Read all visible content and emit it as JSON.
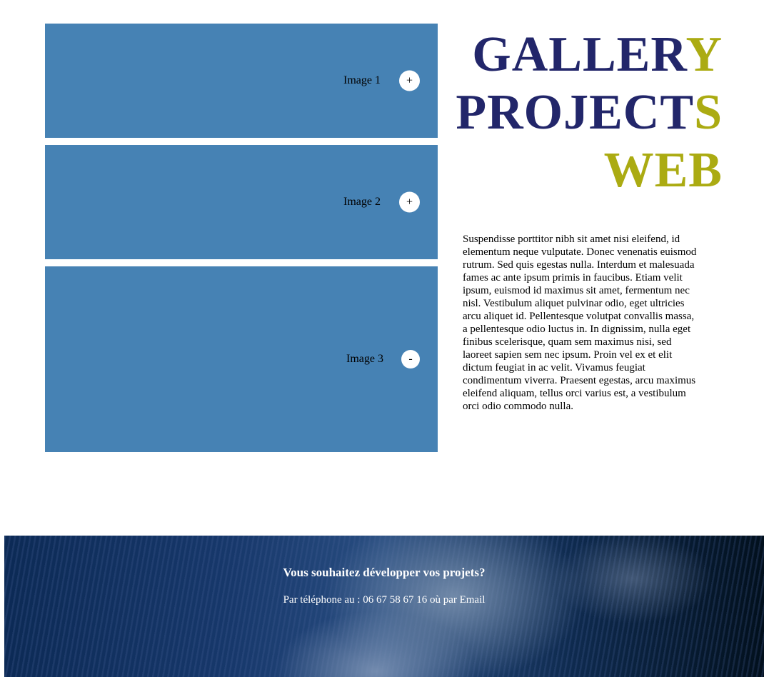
{
  "gallery": {
    "items": [
      {
        "label": "Image 1",
        "toggle": "+"
      },
      {
        "label": "Image 2",
        "toggle": "+"
      },
      {
        "label": "Image 3",
        "toggle": "-"
      }
    ]
  },
  "title": {
    "line1_main": "GALLER",
    "line1_accent": "Y",
    "line2_main": "PROJECT",
    "line2_accent": "S",
    "line3": "WEB"
  },
  "intro": {
    "text": "Suspendisse porttitor nibh sit amet nisi eleifend, id elementum neque vulputate. Donec venenatis euismod rutrum. Sed quis egestas nulla. Interdum et malesuada fames ac ante ipsum primis in faucibus. Etiam velit ipsum, euismod id maximus sit amet, fermentum nec nisl. Vestibulum aliquet pulvinar odio, eget ultricies arcu aliquet id. Pellentesque volutpat convallis massa, a pellentesque odio luctus in. In dignissim, nulla eget finibus scelerisque, quam sem maximus nisi, sed laoreet sapien sem nec ipsum. Proin vel ex et elit dictum feugiat in ac velit. Vivamus feugiat condimentum viverra. Praesent egestas, arcu maximus eleifend aliquam, tellus orci varius est, a vestibulum orci odio commodo nulla."
  },
  "footer": {
    "title": "Vous souhaitez développer vos projets?",
    "contact": "Par téléphone au : 06 67 58 67 16 où par Email"
  },
  "colors": {
    "panel": "#4682b4",
    "title_navy": "#22266a",
    "title_olive": "#abab12"
  }
}
